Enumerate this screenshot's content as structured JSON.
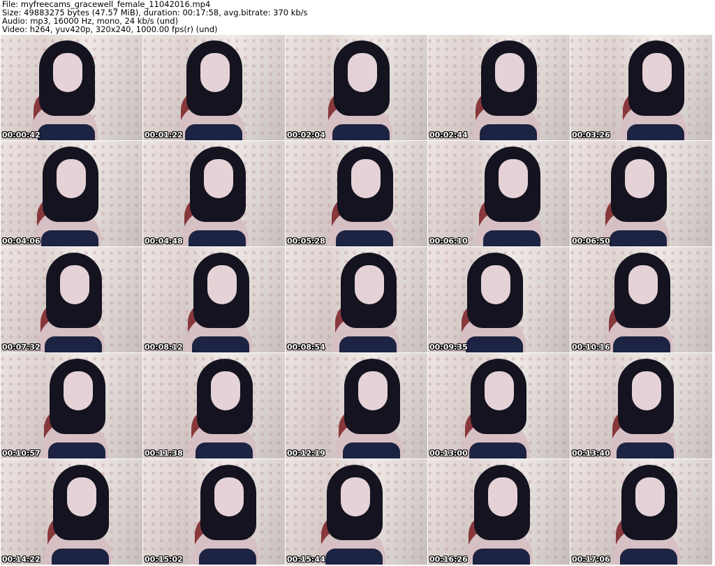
{
  "header": {
    "file": "File: myfreecams_gracewell_female_11042016.mp4",
    "size": "Size: 49883275 bytes (47.57 MiB), duration: 00:17:58, avg.bitrate: 370 kb/s",
    "audio": "Audio: mp3, 16000 Hz, mono, 24 kb/s (und)",
    "video": "Video: h264, yuv420p, 320x240, 1000.00 fps(r) (und)"
  },
  "thumbnails": [
    {
      "timestamp": "00:00:42"
    },
    {
      "timestamp": "00:01:22"
    },
    {
      "timestamp": "00:02:04"
    },
    {
      "timestamp": "00:02:44"
    },
    {
      "timestamp": "00:03:26"
    },
    {
      "timestamp": "00:04:06"
    },
    {
      "timestamp": "00:04:48"
    },
    {
      "timestamp": "00:05:28"
    },
    {
      "timestamp": "00:06:10"
    },
    {
      "timestamp": "00:06:50"
    },
    {
      "timestamp": "00:07:32"
    },
    {
      "timestamp": "00:08:12"
    },
    {
      "timestamp": "00:08:54"
    },
    {
      "timestamp": "00:09:35"
    },
    {
      "timestamp": "00:10:16"
    },
    {
      "timestamp": "00:10:57"
    },
    {
      "timestamp": "00:11:38"
    },
    {
      "timestamp": "00:12:19"
    },
    {
      "timestamp": "00:13:00"
    },
    {
      "timestamp": "00:13:40"
    },
    {
      "timestamp": "00:14:22"
    },
    {
      "timestamp": "00:15:02"
    },
    {
      "timestamp": "00:15:44"
    },
    {
      "timestamp": "00:16:26"
    },
    {
      "timestamp": "00:17:06"
    }
  ]
}
